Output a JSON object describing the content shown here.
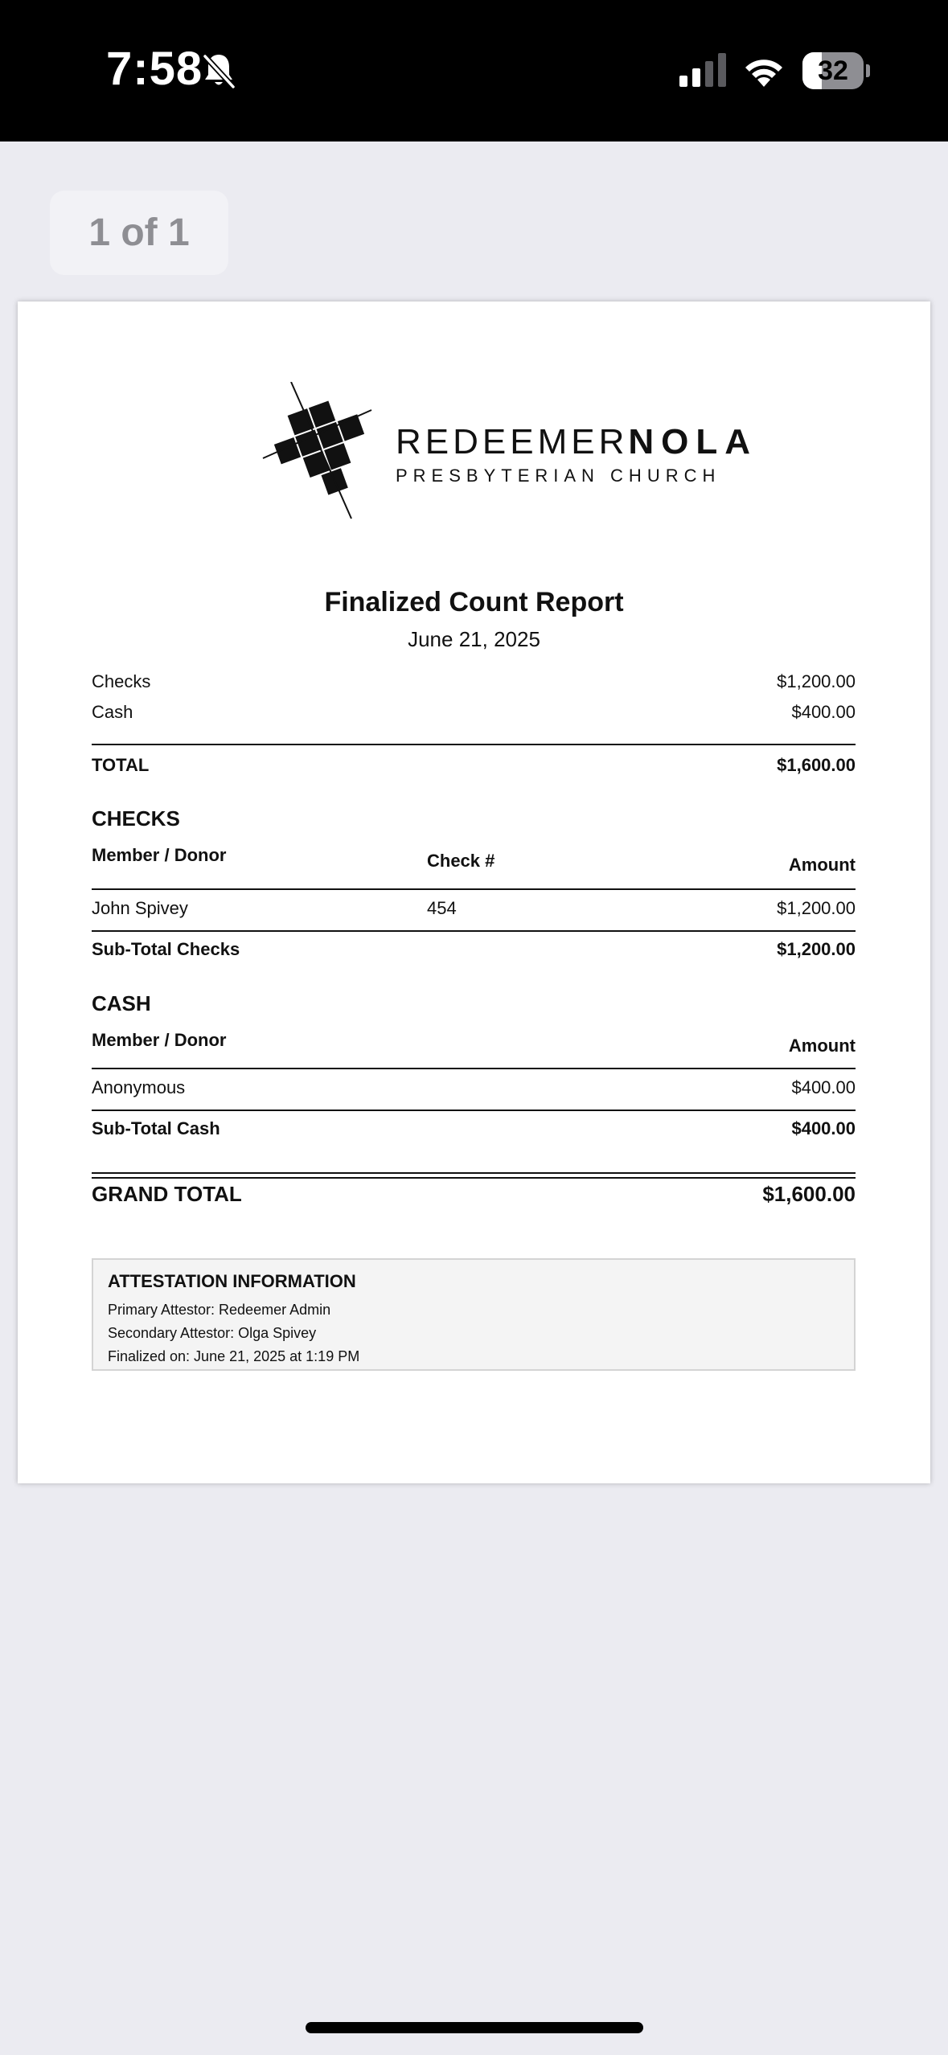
{
  "status_bar": {
    "time": "7:58",
    "battery_level": "32",
    "battery_fraction": 0.32,
    "icons": [
      "bell-slash-icon",
      "cellular-signal-icon",
      "wifi-icon",
      "battery-icon"
    ]
  },
  "viewer": {
    "page_indicator": "1 of 1"
  },
  "document": {
    "logo": {
      "line1_regular": "REDEEMER",
      "line1_bold": "NOLA",
      "line2": "PRESBYTERIAN CHURCH"
    },
    "title": "Finalized Count Report",
    "date": "June 21, 2025",
    "summary": {
      "rows": [
        {
          "label": "Checks",
          "amount": "$1,200.00"
        },
        {
          "label": "Cash",
          "amount": "$400.00"
        }
      ],
      "total_label": "TOTAL",
      "total_amount": "$1,600.00"
    },
    "checks": {
      "title": "CHECKS",
      "headers": {
        "member": "Member / Donor",
        "check_no": "Check #",
        "amount": "Amount"
      },
      "rows": [
        {
          "member": "John Spivey",
          "check_no": "454",
          "amount": "$1,200.00"
        }
      ],
      "subtotal_label": "Sub-Total Checks",
      "subtotal_amount": "$1,200.00"
    },
    "cash": {
      "title": "CASH",
      "headers": {
        "member": "Member / Donor",
        "amount": "Amount"
      },
      "rows": [
        {
          "member": "Anonymous",
          "amount": "$400.00"
        }
      ],
      "subtotal_label": "Sub-Total Cash",
      "subtotal_amount": "$400.00"
    },
    "grand_total_label": "GRAND TOTAL",
    "grand_total_amount": "$1,600.00",
    "attestation": {
      "title": "ATTESTATION INFORMATION",
      "primary": "Primary Attestor: Redeemer Admin",
      "secondary": "Secondary Attestor: Olga Spivey",
      "finalized": "Finalized on: June 21, 2025 at 1:19 PM"
    }
  }
}
